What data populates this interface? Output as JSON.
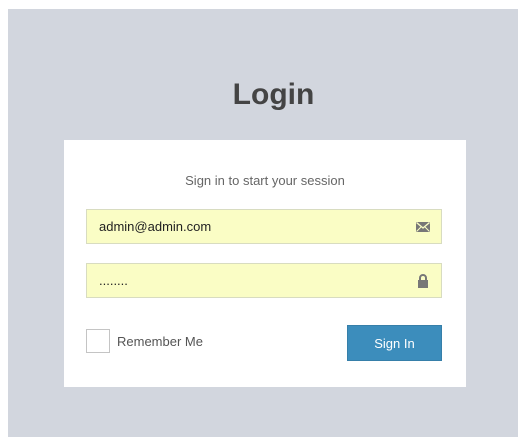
{
  "login": {
    "title": "Login",
    "message": "Sign in to start your session",
    "email": {
      "value": "admin@admin.com",
      "icon": "envelope-icon"
    },
    "password": {
      "value": "........",
      "icon": "lock-icon"
    },
    "remember_label": "Remember Me",
    "remember_checked": false,
    "signin_label": "Sign In"
  },
  "colors": {
    "page_background": "#d2d6de",
    "card_background": "#ffffff",
    "input_autofill_background": "#fafdc5",
    "primary_button": "#3c8dbc",
    "title_text": "#444444"
  }
}
